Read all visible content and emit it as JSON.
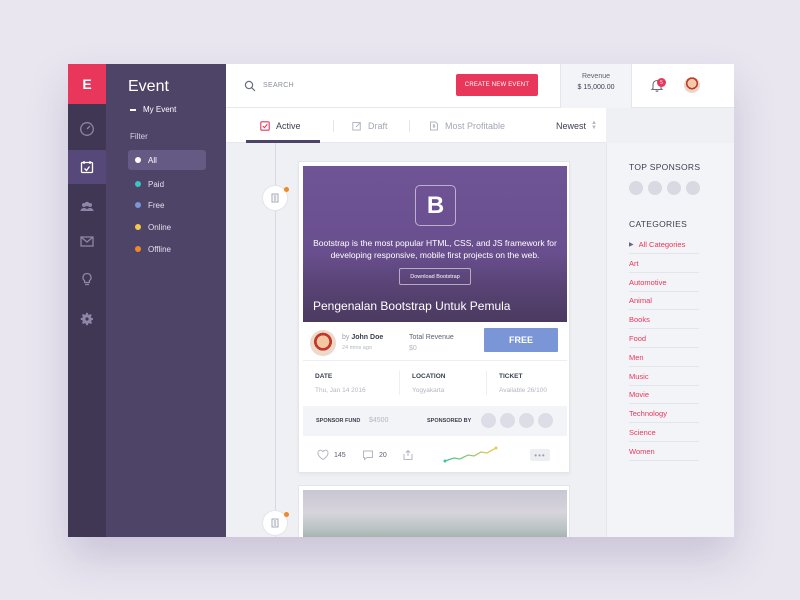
{
  "app": {
    "logo_letter": "E",
    "accent": "#e8375a",
    "sidebar_color": "#4e4468"
  },
  "rail": {
    "items": [
      "dashboard-icon",
      "calendar-icon",
      "people-icon",
      "mail-icon",
      "lightbulb-icon",
      "gear-icon"
    ],
    "active": "calendar-icon"
  },
  "sidebar": {
    "title": "Event",
    "my_event": "My Event",
    "filter_label": "Filter",
    "filters": [
      {
        "label": "All",
        "color": "#ffffff"
      },
      {
        "label": "Paid",
        "color": "#3cc5c5"
      },
      {
        "label": "Free",
        "color": "#7b96d6"
      },
      {
        "label": "Online",
        "color": "#f2c94c"
      },
      {
        "label": "Offline",
        "color": "#f08a24"
      }
    ]
  },
  "header": {
    "search_placeholder": "SEARCH",
    "create_label": "CREATE NEW EVENT",
    "revenue_label": "Revenue",
    "revenue_value": "$ 15,000.00",
    "notification_count": "5"
  },
  "tabs": {
    "items": [
      {
        "label": "Active"
      },
      {
        "label": "Draft"
      },
      {
        "label": "Most Profitable"
      }
    ],
    "sort_label": "Newest"
  },
  "event": {
    "hero_logo": "B",
    "hero_description": "Bootstrap is the most popular HTML, CSS, and JS framework for developing responsive, mobile first projects on the web.",
    "hero_button": "Download Bootstrap",
    "title": "Pengenalan Bootstrap Untuk Pemula",
    "by_prefix": "by",
    "author": "John Doe",
    "posted": "24 mins ago",
    "total_revenue_label": "Total Revenue",
    "total_revenue_value": "$0",
    "price_label": "FREE",
    "date_label": "DATE",
    "date_value": "Thu, Jan 14 2016",
    "location_label": "LOCATION",
    "location_value": "Yogyakarta",
    "ticket_label": "TICKET",
    "ticket_value": "Available 26/100",
    "sponsor_fund_label": "SPONSOR FUND",
    "sponsor_fund_value": "$4500",
    "sponsored_by_label": "SPONSORED BY",
    "likes": "145",
    "comments": "20"
  },
  "right_panel": {
    "top_sponsors_title": "TOP SPONSORS",
    "categories_title": "CATEGORIES",
    "categories": [
      "All Categories",
      "Art",
      "Automotive",
      "Animal",
      "Books",
      "Food",
      "Men",
      "Music",
      "Movie",
      "Technology",
      "Science",
      "Women"
    ]
  }
}
